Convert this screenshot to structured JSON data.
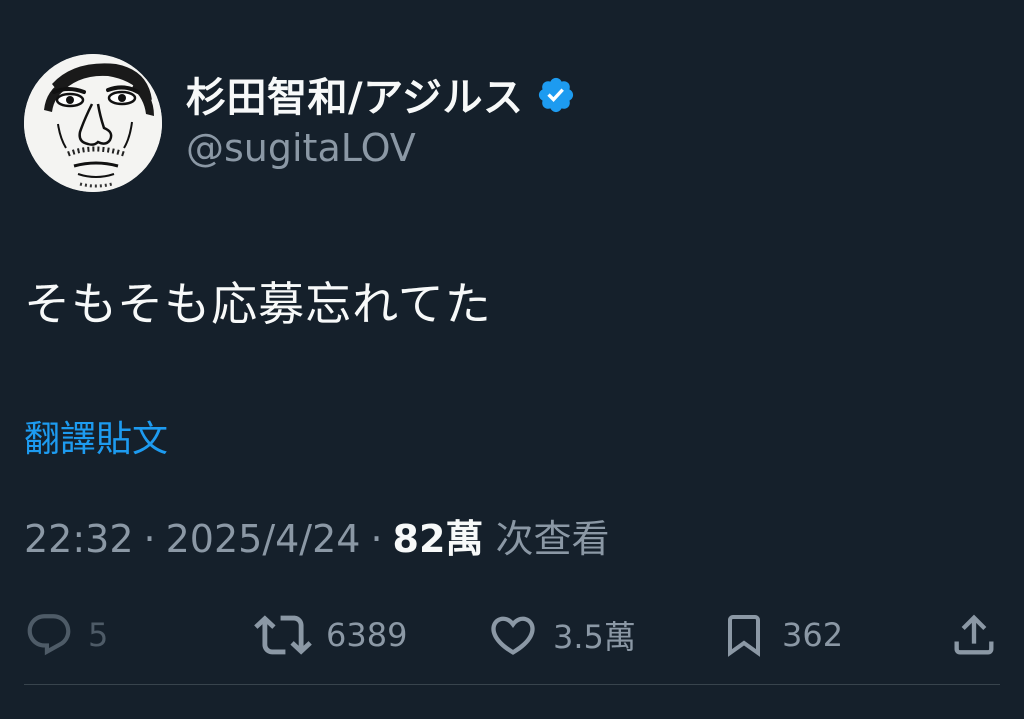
{
  "author": {
    "display_name": "杉田智和/アジルス",
    "handle": "@sugitaLOV",
    "verified": true,
    "avatar_icon": "caricature-face-avatar"
  },
  "tweet": {
    "text": "そもそも応募忘れてた",
    "translate_label": "翻譯貼文"
  },
  "meta": {
    "time": "22:32",
    "separator": "·",
    "date": "2025/4/24",
    "views_count": "82萬",
    "views_label": "次查看"
  },
  "actions": {
    "reply": {
      "icon": "reply-icon",
      "count": "5"
    },
    "retweet": {
      "icon": "retweet-icon",
      "count": "6389"
    },
    "like": {
      "icon": "heart-icon",
      "count": "3.5萬"
    },
    "bookmark": {
      "icon": "bookmark-icon",
      "count": "362"
    },
    "share": {
      "icon": "share-icon"
    }
  },
  "colors": {
    "background": "#15202b",
    "primary_text": "#f7f9f9",
    "secondary_text": "#8b98a5",
    "accent": "#1d9bf0",
    "divider": "#38444d"
  }
}
